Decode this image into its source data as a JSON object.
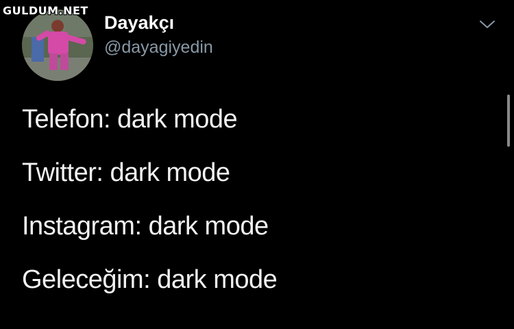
{
  "watermark": "GULDUM.NET",
  "tweet": {
    "author": {
      "display_name": "Dayakçı",
      "handle": "@dayagiyedin"
    },
    "lines": [
      "Telefon: dark mode",
      "Twitter: dark mode",
      "Instagram: dark mode",
      "Geleceğim: dark mode"
    ]
  },
  "icons": {
    "menu": "chevron-down-icon"
  },
  "colors": {
    "background": "#000000",
    "text": "#f2f2f2",
    "handle": "#8899a6",
    "chevron": "#8899a6"
  }
}
